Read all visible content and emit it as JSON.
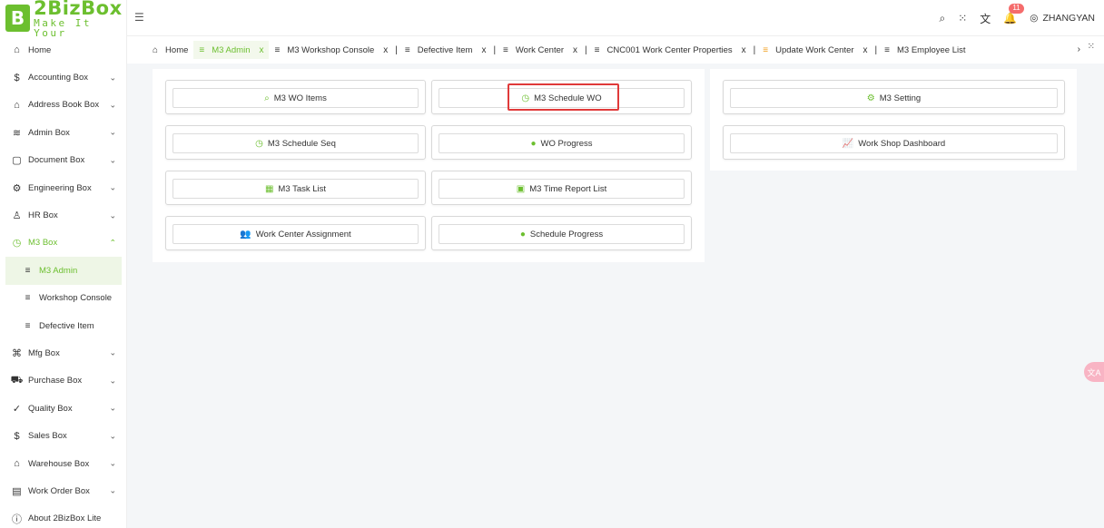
{
  "logo": {
    "box": "B",
    "main": "2BizBox",
    "sub": "Make It Your"
  },
  "sidebar": {
    "items": [
      {
        "label": "Home",
        "icon": "⌂"
      },
      {
        "label": "Accounting Box",
        "icon": "$"
      },
      {
        "label": "Address Book Box",
        "icon": "⌂"
      },
      {
        "label": "Admin Box",
        "icon": "≋"
      },
      {
        "label": "Document Box",
        "icon": "▢"
      },
      {
        "label": "Engineering Box",
        "icon": "⚙"
      },
      {
        "label": "HR Box",
        "icon": "♙"
      },
      {
        "label": "M3 Box",
        "icon": "◷"
      },
      {
        "label": "M3 Admin",
        "icon": "≡"
      },
      {
        "label": "Workshop Console",
        "icon": "≡"
      },
      {
        "label": "Defective Item",
        "icon": "≡"
      },
      {
        "label": "Mfg Box",
        "icon": "⌘"
      },
      {
        "label": "Purchase Box",
        "icon": "⛟"
      },
      {
        "label": "Quality Box",
        "icon": "✓"
      },
      {
        "label": "Sales Box",
        "icon": "$"
      },
      {
        "label": "Warehouse Box",
        "icon": "⌂"
      },
      {
        "label": "Work Order Box",
        "icon": "▤"
      },
      {
        "label": "About 2BizBox Lite",
        "icon": "ⓘ"
      }
    ],
    "chevron_down": "⌄",
    "chevron_up": "⌃"
  },
  "topbar": {
    "collapse_icon": "☰",
    "search_icon": "⌕",
    "apps_icon": "⁙",
    "translate_icon": "文",
    "bell_icon": "🔔",
    "notification_count": "11",
    "user_icon": "◎",
    "username": "ZHANGYAN"
  },
  "tabs": [
    {
      "label": "Home",
      "icon": "⌂",
      "closable": false
    },
    {
      "label": "M3 Admin",
      "icon": "≡",
      "closable": true
    },
    {
      "label": "M3 Workshop Console",
      "icon": "≡",
      "closable": true
    },
    {
      "label": "Defective Item",
      "icon": "≡",
      "closable": true
    },
    {
      "label": "Work Center",
      "icon": "≡",
      "closable": true
    },
    {
      "label": "CNC001 Work Center Properties",
      "icon": "≡",
      "closable": true
    },
    {
      "label": "Update Work Center",
      "icon": "≡",
      "closable": true
    },
    {
      "label": "M3 Employee List",
      "icon": "≡",
      "closable": false
    }
  ],
  "tab_close": "x",
  "tab_sep": "|",
  "tab_more": "›",
  "tab_full": "⁙",
  "cards_left": [
    {
      "label": "M3 WO Items",
      "icon": "⌕"
    },
    {
      "label": "M3 Schedule WO",
      "icon": "◷"
    },
    {
      "label": "M3 Schedule Seq",
      "icon": "◷"
    },
    {
      "label": "WO Progress",
      "icon": "●"
    },
    {
      "label": "M3 Task List",
      "icon": "▦"
    },
    {
      "label": "M3 Time Report List",
      "icon": "▣"
    },
    {
      "label": "Work Center Assignment",
      "icon": "👥"
    },
    {
      "label": "Schedule Progress",
      "icon": "●"
    }
  ],
  "cards_right": [
    {
      "label": "M3 Setting",
      "icon": "⚙"
    },
    {
      "label": "Work Shop Dashboard",
      "icon": "📈"
    }
  ],
  "float_button": "文A",
  "colors": {
    "accent": "#6cbf2f",
    "highlight": "#e03a3a",
    "badge": "#f56c6c"
  }
}
